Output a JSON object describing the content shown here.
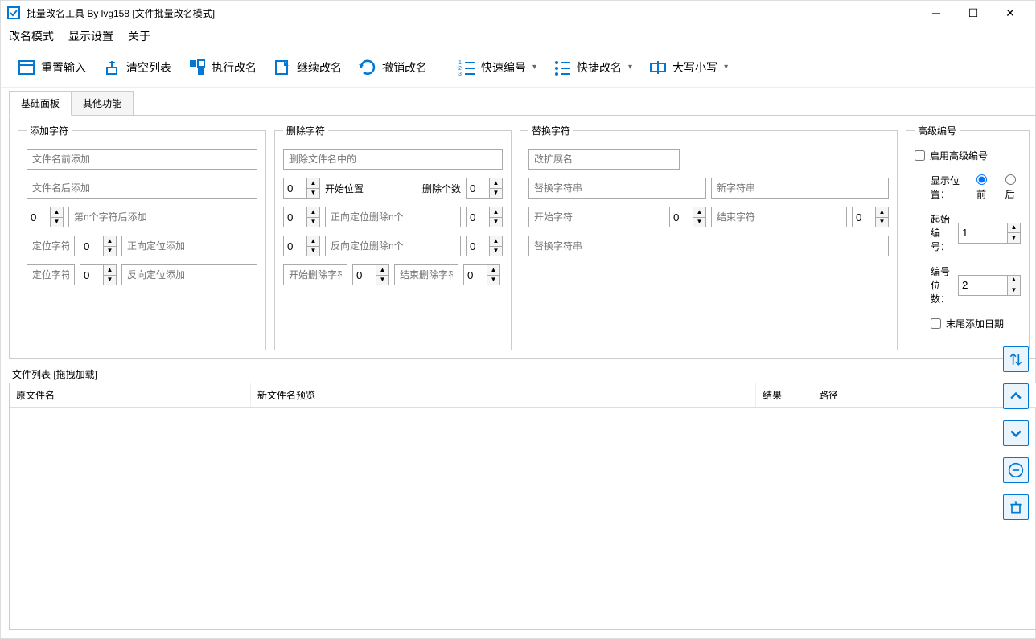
{
  "title": "批量改名工具  By lvg158     [文件批量改名模式]",
  "menu": {
    "mode": "改名模式",
    "display": "显示设置",
    "about": "关于"
  },
  "toolbar": {
    "reset": "重置输入",
    "clear": "清空列表",
    "exec": "执行改名",
    "continue": "继续改名",
    "undo": "撤销改名",
    "quicknum": "快速编号",
    "quickrename": "快捷改名",
    "case": "大写小写"
  },
  "tabs": {
    "basic": "基础面板",
    "other": "其他功能"
  },
  "add": {
    "legend": "添加字符",
    "before_ph": "文件名前添加",
    "after_ph": "文件名后添加",
    "n_val": "0",
    "n_ph": "第n个字符后添加",
    "loc1_ph": "定位字符",
    "loc1_val": "0",
    "fwd_ph": "正向定位添加",
    "loc2_ph": "定位字符",
    "loc2_val": "0",
    "rev_ph": "反向定位添加"
  },
  "del": {
    "legend": "删除字符",
    "in_ph": "删除文件名中的",
    "start_val": "0",
    "start_lbl": "开始位置",
    "count_lbl": "删除个数",
    "count_val": "0",
    "fwd_val": "0",
    "fwd_ph": "正向定位删除n个",
    "fwd_cnt": "0",
    "rev_val": "0",
    "rev_ph": "反向定位删除n个",
    "rev_cnt": "0",
    "startdel_ph": "开始删除字符",
    "startdel_val": "0",
    "enddel_ph": "结束删除字符",
    "enddel_val": "0"
  },
  "rep": {
    "legend": "替换字符",
    "ext_ph": "改扩展名",
    "find_ph": "替换字符串",
    "new_ph": "新字符串",
    "startc_ph": "开始字符",
    "startc_val": "0",
    "endc_ph": "结束字符",
    "endc_val": "0",
    "rep2_ph": "替换字符串"
  },
  "num": {
    "legend": "高级编号",
    "enable": "启用高级编号",
    "pos_lbl": "显示位置：",
    "pos_front": "前",
    "pos_back": "后",
    "start_lbl": "起始编号：",
    "start_val": "1",
    "digits_lbl": "编号位数：",
    "digits_val": "2",
    "append_date": "末尾添加日期"
  },
  "filelist": {
    "label": "文件列表  [拖拽加载]",
    "col_orig": "原文件名",
    "col_new": "新文件名预览",
    "col_result": "结果",
    "col_path": "路径"
  }
}
